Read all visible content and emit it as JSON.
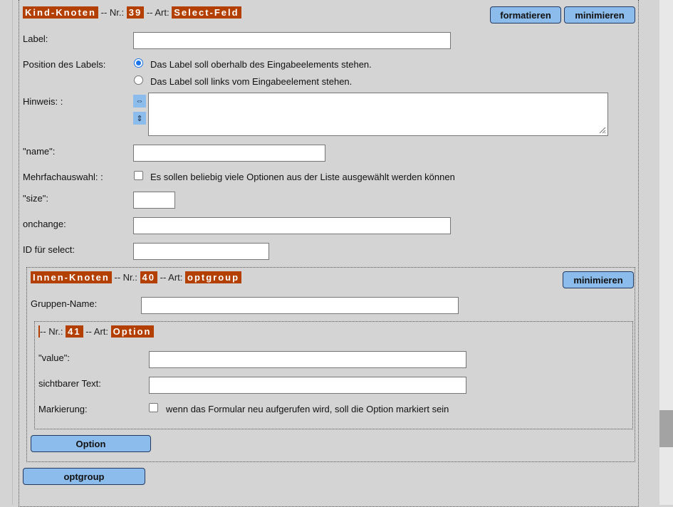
{
  "outer_node": {
    "type_tag": "Kind-Knoten",
    "nr_label": "-- Nr.:",
    "nr_value": "39",
    "art_label": "-- Art:",
    "art_value": "Select-Feld",
    "format_button": "formatieren",
    "minimize_button": "minimieren",
    "fields": {
      "label_label": "Label:",
      "label_value": "",
      "position_label": "Position des Labels:",
      "position_options": [
        {
          "label": "Das Label soll oberhalb des Eingabeelements stehen.",
          "checked": true
        },
        {
          "label": "Das Label soll links vom Eingabeelement stehen.",
          "checked": false
        }
      ],
      "hint_label": "Hinweis: :",
      "hint_value": "",
      "hint_buttons": {
        "horizontal": "⇔",
        "vertical": "⇕"
      },
      "name_label": "\"name\":",
      "name_value": "",
      "multiple_label": "Mehrfachauswahl: :",
      "multiple_option": "Es sollen beliebig viele Optionen aus der Liste ausgewählt werden können",
      "multiple_checked": false,
      "size_label": "\"size\":",
      "size_value": "",
      "onchange_label": "onchange:",
      "onchange_value": "",
      "id_label": "ID für select:",
      "id_value": ""
    }
  },
  "inner_node": {
    "type_tag": "Innen-Knoten",
    "nr_label": "-- Nr.:",
    "nr_value": "40",
    "art_label": "-- Art:",
    "art_value": "optgroup",
    "minimize_button": "minimieren",
    "group_name_label": "Gruppen-Name:",
    "group_name_value": ""
  },
  "option_node": {
    "nr_label": "-- Nr.:",
    "nr_value": "41",
    "art_label": "-- Art:",
    "art_value": "Option",
    "value_label": "\"value\":",
    "value_value": "",
    "text_label": "sichtbarer Text:",
    "text_value": "",
    "marking_label": "Markierung:",
    "marking_option": "wenn das Formular neu aufgerufen wird, soll die Option markiert sein",
    "marking_checked": false
  },
  "add_option_button": "Option",
  "add_optgroup_button": "optgroup"
}
